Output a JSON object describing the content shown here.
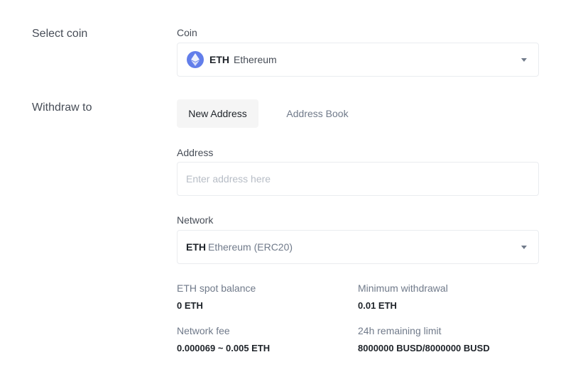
{
  "select_coin": {
    "row_label": "Select coin",
    "field_label": "Coin",
    "selected": {
      "ticker": "ETH",
      "name": "Ethereum",
      "icon": "ethereum-icon",
      "icon_color": "#627eea"
    }
  },
  "withdraw_to": {
    "row_label": "Withdraw to",
    "tabs": [
      {
        "label": "New Address",
        "active": true
      },
      {
        "label": "Address Book",
        "active": false
      }
    ],
    "address": {
      "label": "Address",
      "placeholder": "Enter address here",
      "value": ""
    },
    "network": {
      "label": "Network",
      "ticker": "ETH",
      "name": "Ethereum (ERC20)"
    }
  },
  "info": {
    "spot_balance_label": "ETH spot balance",
    "spot_balance_value": "0 ETH",
    "min_withdrawal_label": "Minimum withdrawal",
    "min_withdrawal_value": "0.01 ETH",
    "network_fee_label": "Network fee",
    "network_fee_value": "0.000069 ~ 0.005 ETH",
    "remaining_limit_label": "24h remaining limit",
    "remaining_limit_value": "8000000 BUSD/8000000 BUSD"
  },
  "colors": {
    "text_primary": "#1e2329",
    "text_secondary": "#707a8a",
    "border": "#eaecef",
    "tab_active_bg": "#f5f5f5"
  }
}
